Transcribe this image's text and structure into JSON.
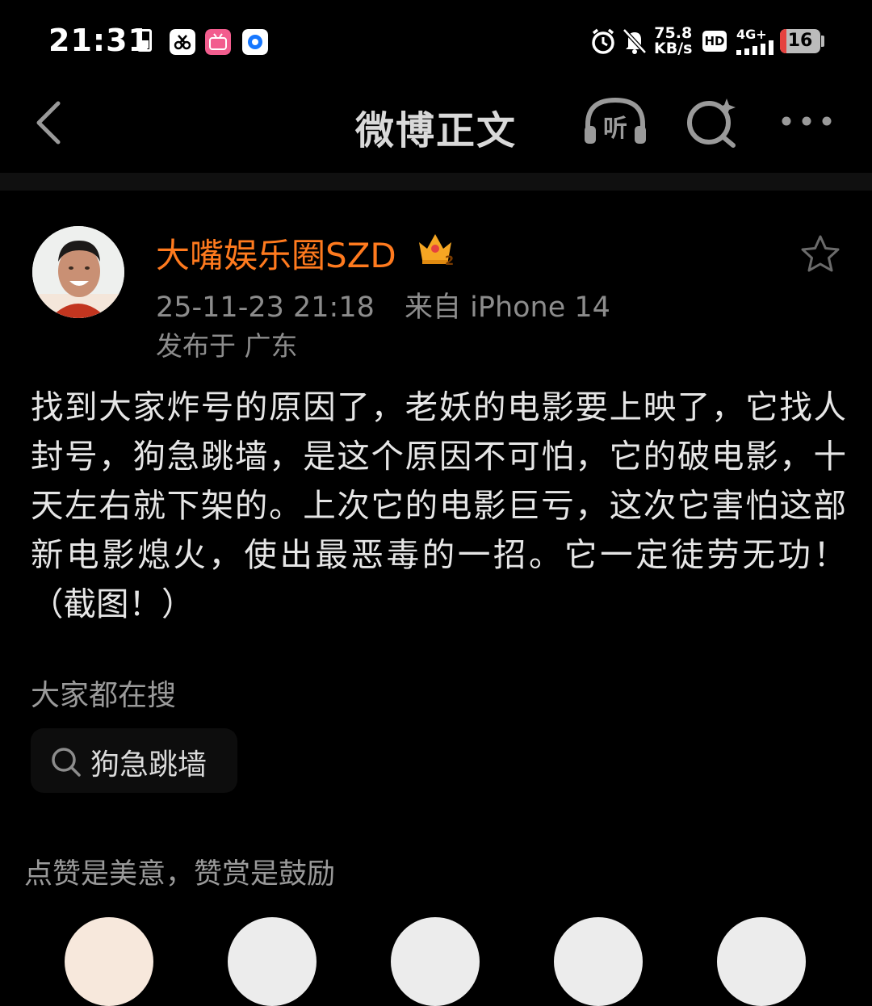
{
  "status_bar": {
    "time": "21:31",
    "net_speed_value": "75.8",
    "net_speed_unit": "KB/s",
    "hd_label": "HD",
    "signal_label": "4G+",
    "battery_level": "16",
    "battery_fraction": 0.16,
    "icons": [
      "battery-small-icon",
      "scissors-app-icon",
      "bilibili-app-icon",
      "browser-app-icon",
      "alarm-icon",
      "mute-bell-icon",
      "signal-icon"
    ]
  },
  "nav": {
    "title": "微博正文",
    "back_icon": "chevron-left-icon",
    "listen_icon": "headphones-listen-icon",
    "listen_label": "听",
    "search_icon": "sparkle-search-icon",
    "more_icon": "more-dots-icon"
  },
  "post": {
    "author_name": "大嘴娱乐圈SZD",
    "author_badge": "crown-icon",
    "badge_level": "2",
    "time": "25-11-23 21:18",
    "source": "来自 iPhone 14",
    "location": "发布于 广东",
    "text": "找到大家炸号的原因了，老妖的电影要上映了，它找人封号，狗急跳墙，是这个原因不可怕，它的破电影，十天左右就下架的。上次它的电影巨亏，这次它害怕这部新电影熄火，使出最恶毒的一招。它一定徒劳无功！（截图！）",
    "favorite_icon": "star-outline-icon"
  },
  "hot_search": {
    "label": "大家都在搜",
    "chip_label": "狗急跳墙",
    "chip_icon": "search-icon"
  },
  "reward": {
    "label": "点赞是美意，赞赏是鼓励"
  },
  "colors": {
    "background": "#000000",
    "author_name": "#ff7a1e",
    "secondary_text": "#8c8c8c",
    "battery_low": "#e5423f"
  }
}
